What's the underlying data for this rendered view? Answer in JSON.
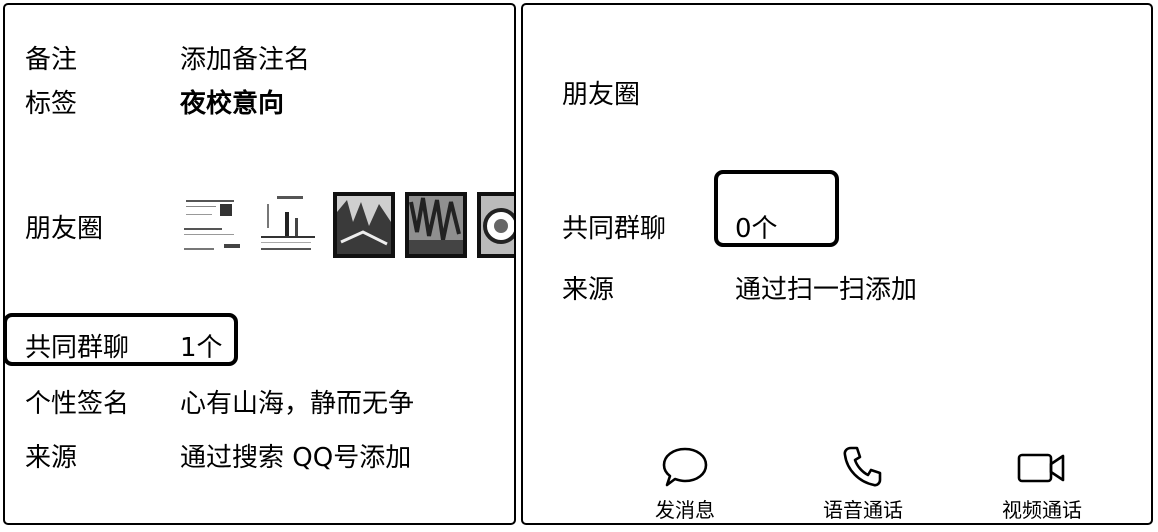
{
  "left": {
    "remark": {
      "label": "备注",
      "value": "添加备注名"
    },
    "tag": {
      "label": "标签",
      "value": "夜校意向"
    },
    "moments": {
      "label": "朋友圈"
    },
    "common_groups": {
      "label": "共同群聊",
      "value": "1个"
    },
    "signature": {
      "label": "个性签名",
      "value": "心有山海，静而无争"
    },
    "source": {
      "label": "来源",
      "value": "通过搜索 QQ号添加"
    }
  },
  "right": {
    "moments": {
      "label": "朋友圈"
    },
    "common_groups": {
      "label": "共同群聊",
      "value": "0个"
    },
    "source": {
      "label": "来源",
      "value": "通过扫一扫添加"
    },
    "actions": [
      {
        "label": "发消息",
        "icon": "chat-bubble-icon"
      },
      {
        "label": "语音通话",
        "icon": "phone-icon"
      },
      {
        "label": "视频通话",
        "icon": "video-camera-icon"
      }
    ]
  }
}
